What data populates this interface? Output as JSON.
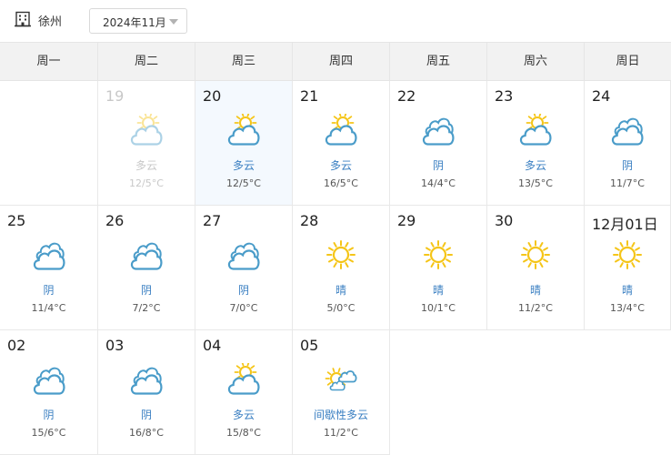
{
  "header": {
    "city": "徐州",
    "city_icon": "building-icon",
    "month_select": {
      "value": "2024年11月",
      "icon": "caret-down-icon"
    }
  },
  "weekdays": [
    "周一",
    "周二",
    "周三",
    "周四",
    "周五",
    "周六",
    "周日"
  ],
  "rows": [
    [
      {
        "date": "",
        "cond": "",
        "temp": "",
        "icon": "",
        "state": "empty"
      },
      {
        "date": "19",
        "cond": "多云",
        "temp": "12/5°C",
        "icon": "partly-cloudy-icon",
        "state": "past"
      },
      {
        "date": "20",
        "cond": "多云",
        "temp": "12/5°C",
        "icon": "partly-cloudy-icon",
        "state": "today"
      },
      {
        "date": "21",
        "cond": "多云",
        "temp": "16/5°C",
        "icon": "partly-cloudy-icon",
        "state": ""
      },
      {
        "date": "22",
        "cond": "阴",
        "temp": "14/4°C",
        "icon": "overcast-icon",
        "state": ""
      },
      {
        "date": "23",
        "cond": "多云",
        "temp": "13/5°C",
        "icon": "partly-cloudy-icon",
        "state": ""
      },
      {
        "date": "24",
        "cond": "阴",
        "temp": "11/7°C",
        "icon": "overcast-icon",
        "state": ""
      }
    ],
    [
      {
        "date": "25",
        "cond": "阴",
        "temp": "11/4°C",
        "icon": "overcast-icon",
        "state": ""
      },
      {
        "date": "26",
        "cond": "阴",
        "temp": "7/2°C",
        "icon": "overcast-icon",
        "state": ""
      },
      {
        "date": "27",
        "cond": "阴",
        "temp": "7/0°C",
        "icon": "overcast-icon",
        "state": ""
      },
      {
        "date": "28",
        "cond": "晴",
        "temp": "5/0°C",
        "icon": "sunny-icon",
        "state": ""
      },
      {
        "date": "29",
        "cond": "晴",
        "temp": "10/1°C",
        "icon": "sunny-icon",
        "state": ""
      },
      {
        "date": "30",
        "cond": "晴",
        "temp": "11/2°C",
        "icon": "sunny-icon",
        "state": ""
      },
      {
        "date": "12月01日",
        "cond": "晴",
        "temp": "13/4°C",
        "icon": "sunny-icon",
        "state": ""
      }
    ],
    [
      {
        "date": "02",
        "cond": "阴",
        "temp": "15/6°C",
        "icon": "overcast-icon",
        "state": ""
      },
      {
        "date": "03",
        "cond": "阴",
        "temp": "16/8°C",
        "icon": "overcast-icon",
        "state": ""
      },
      {
        "date": "04",
        "cond": "多云",
        "temp": "15/8°C",
        "icon": "partly-cloudy-icon",
        "state": ""
      },
      {
        "date": "05",
        "cond": "间歇性多云",
        "temp": "11/2°C",
        "icon": "intermittent-cloudy-icon",
        "state": ""
      }
    ]
  ],
  "colors": {
    "cloud_stroke": "#4a9cc9",
    "sun": "#f5c518",
    "condition_text": "#3a7fc2",
    "today_bg": "#f4f9fe",
    "header_bg": "#f2f2f2"
  }
}
